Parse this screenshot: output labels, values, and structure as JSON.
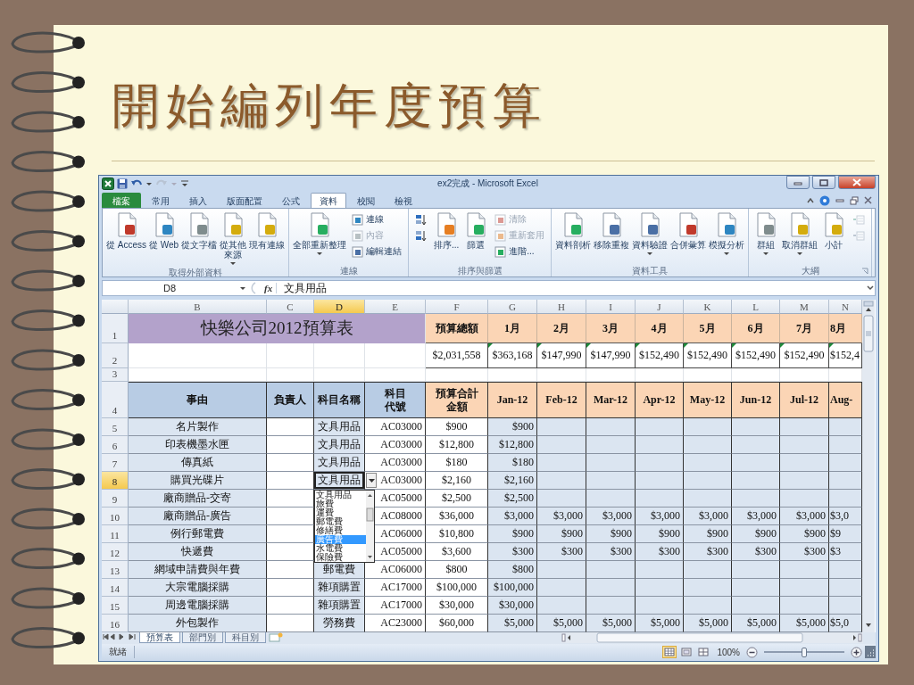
{
  "slide": {
    "title": "開始編列年度預算"
  },
  "window": {
    "title": "ex2完成 - Microsoft Excel"
  },
  "ribbon_tabs": [
    {
      "label": "檔案",
      "kind": "file",
      "selected": false
    },
    {
      "label": "常用",
      "kind": "tab",
      "selected": false
    },
    {
      "label": "插入",
      "kind": "tab",
      "selected": false
    },
    {
      "label": "版面配置",
      "kind": "tab",
      "selected": false
    },
    {
      "label": "公式",
      "kind": "tab",
      "selected": false
    },
    {
      "label": "資料",
      "kind": "tab",
      "selected": true
    },
    {
      "label": "校閱",
      "kind": "tab",
      "selected": false
    },
    {
      "label": "檢視",
      "kind": "tab",
      "selected": false
    }
  ],
  "ribbon_groups": [
    {
      "label": "取得外部資料",
      "items": [
        {
          "kind": "large",
          "label": "從 Access",
          "disabled": false
        },
        {
          "kind": "large",
          "label": "從 Web",
          "disabled": false
        },
        {
          "kind": "large",
          "label": "從文字檔",
          "disabled": false
        },
        {
          "kind": "large",
          "label": [
            "從其他",
            "來源"
          ],
          "menu": true,
          "disabled": false
        },
        {
          "kind": "large",
          "label": "現有連線",
          "disabled": false
        }
      ]
    },
    {
      "label": "連線",
      "items": [
        {
          "kind": "large",
          "label": "全部重新整理",
          "menu": true,
          "disabled": false
        },
        {
          "kind": "small",
          "label": "連線",
          "disabled": false
        },
        {
          "kind": "small",
          "label": "內容",
          "disabled": true
        },
        {
          "kind": "small",
          "label": "編輯連結",
          "disabled": false
        }
      ]
    },
    {
      "label": "排序與篩選",
      "items": [
        {
          "kind": "sort-ascending",
          "disabled": false
        },
        {
          "kind": "sort-descending",
          "disabled": false
        },
        {
          "kind": "large",
          "label": "排序...",
          "disabled": false
        },
        {
          "kind": "large",
          "label": "篩選",
          "disabled": false
        },
        {
          "kind": "small",
          "label": "清除",
          "disabled": true
        },
        {
          "kind": "small",
          "label": "重新套用",
          "disabled": true
        },
        {
          "kind": "small",
          "label": "進階...",
          "disabled": false
        }
      ]
    },
    {
      "label": "資料工具",
      "items": [
        {
          "kind": "large",
          "label": "資料剖析",
          "disabled": false
        },
        {
          "kind": "large",
          "label": "移除重複",
          "disabled": false
        },
        {
          "kind": "large",
          "label": "資料驗證",
          "menu": true,
          "disabled": false
        },
        {
          "kind": "large",
          "label": "合併彙算",
          "disabled": false
        },
        {
          "kind": "large",
          "label": "模擬分析",
          "menu": true,
          "disabled": false
        }
      ]
    },
    {
      "label": "大綱",
      "launcher": true,
      "items": [
        {
          "kind": "large",
          "label": "群組",
          "menu": true,
          "disabled": false
        },
        {
          "kind": "large",
          "label": "取消群組",
          "menu": true,
          "disabled": false
        },
        {
          "kind": "large",
          "label": "小計",
          "disabled": false
        },
        {
          "kind": "show-detail",
          "disabled": true
        },
        {
          "kind": "hide-detail",
          "disabled": true
        }
      ]
    }
  ],
  "formula_bar": {
    "name_box": "D8",
    "insert_function": "fx",
    "formula": "文具用品"
  },
  "sheet": {
    "columns": [
      {
        "letter": "B",
        "selected": false
      },
      {
        "letter": "C",
        "selected": false
      },
      {
        "letter": "D",
        "selected": true
      },
      {
        "letter": "E",
        "selected": false
      },
      {
        "letter": "F",
        "selected": false
      },
      {
        "letter": "G",
        "selected": false
      },
      {
        "letter": "H",
        "selected": false
      },
      {
        "letter": "I",
        "selected": false
      },
      {
        "letter": "J",
        "selected": false
      },
      {
        "letter": "K",
        "selected": false
      },
      {
        "letter": "L",
        "selected": false
      },
      {
        "letter": "M",
        "selected": false
      },
      {
        "letter": "N",
        "selected": false
      }
    ],
    "rows": [
      {
        "number": "1",
        "kind": "title",
        "selected": false,
        "cells": {
          "B": "快樂公司2012預算表",
          "F": "預算總額",
          "G": "1月",
          "H": "2月",
          "I": "3月",
          "J": "4月",
          "K": "5月",
          "L": "6月",
          "M": "7月",
          "N": "8月"
        }
      },
      {
        "number": "2",
        "kind": "totals",
        "selected": false,
        "cells": {
          "F": "$2,031,558",
          "G": {
            "text": "$363,168",
            "flagged": true
          },
          "H": {
            "text": "$147,990",
            "flagged": true
          },
          "I": {
            "text": "$147,990",
            "flagged": true
          },
          "J": {
            "text": "$152,490",
            "flagged": true
          },
          "K": {
            "text": "$152,490",
            "flagged": true
          },
          "L": {
            "text": "$152,490",
            "flagged": true
          },
          "M": {
            "text": "$152,490",
            "flagged": true
          },
          "N": {
            "text": "$152,4",
            "flagged": true
          }
        }
      },
      {
        "number": "3",
        "kind": "blank",
        "selected": false,
        "cells": {}
      },
      {
        "number": "4",
        "kind": "header",
        "selected": false,
        "cells": {
          "B": "事由",
          "C": "負責人",
          "D": "科目名稱",
          "E": [
            "科目",
            "代號"
          ],
          "F": [
            "預算合計",
            "金額"
          ],
          "G": "Jan-12",
          "H": "Feb-12",
          "I": "Mar-12",
          "J": "Apr-12",
          "K": "May-12",
          "L": "Jun-12",
          "M": "Jul-12",
          "N": "Aug-"
        }
      },
      {
        "number": "5",
        "kind": "item",
        "selected": false,
        "cells": {
          "B": "名片製作",
          "D": "文具用品",
          "E": "AC03000",
          "F": "$900",
          "G": "$900"
        }
      },
      {
        "number": "6",
        "kind": "item",
        "selected": false,
        "cells": {
          "B": "印表機墨水匣",
          "D": "文具用品",
          "E": "AC03000",
          "F": "$12,800",
          "G": "$12,800"
        }
      },
      {
        "number": "7",
        "kind": "item",
        "selected": false,
        "cells": {
          "B": "傳真紙",
          "D": "文具用品",
          "E": "AC03000",
          "F": "$180",
          "G": "$180"
        }
      },
      {
        "number": "8",
        "kind": "item",
        "selected": true,
        "cells": {
          "B": "購買光碟片",
          "D": "文具用品",
          "E": "AC03000",
          "F": "$2,160",
          "G": "$2,160"
        }
      },
      {
        "number": "9",
        "kind": "item",
        "selected": false,
        "cells": {
          "B": "廠商贈品-交寄",
          "E": "AC05000",
          "F": "$2,500",
          "G": "$2,500"
        }
      },
      {
        "number": "10",
        "kind": "item",
        "selected": false,
        "cells": {
          "B": "廠商贈品-廣告",
          "E": "AC08000",
          "F": "$36,000",
          "G": "$3,000",
          "H": "$3,000",
          "I": "$3,000",
          "J": "$3,000",
          "K": "$3,000",
          "L": "$3,000",
          "M": "$3,000",
          "N": "$3,0"
        }
      },
      {
        "number": "11",
        "kind": "item",
        "selected": false,
        "cells": {
          "B": "例行郵電費",
          "E": "AC06000",
          "F": "$10,800",
          "G": "$900",
          "H": "$900",
          "I": "$900",
          "J": "$900",
          "K": "$900",
          "L": "$900",
          "M": "$900",
          "N": "$9"
        }
      },
      {
        "number": "12",
        "kind": "item",
        "selected": false,
        "cells": {
          "B": "快遞費",
          "E": "AC05000",
          "F": "$3,600",
          "G": "$300",
          "H": "$300",
          "I": "$300",
          "J": "$300",
          "K": "$300",
          "L": "$300",
          "M": "$300",
          "N": "$3"
        }
      },
      {
        "number": "13",
        "kind": "item",
        "selected": false,
        "cells": {
          "B": "網域申請費與年費",
          "D": "郵電費",
          "E": "AC06000",
          "F": "$800",
          "G": "$800"
        }
      },
      {
        "number": "14",
        "kind": "item",
        "selected": false,
        "cells": {
          "B": "大宗電腦採購",
          "D": "雜項購置",
          "E": "AC17000",
          "F": "$100,000",
          "G": "$100,000"
        }
      },
      {
        "number": "15",
        "kind": "item",
        "selected": false,
        "cells": {
          "B": "周邊電腦採購",
          "D": "雜項購置",
          "E": "AC17000",
          "F": "$30,000",
          "G": "$30,000"
        }
      },
      {
        "number": "16",
        "kind": "item",
        "selected": false,
        "cells": {
          "B": "外包製作",
          "D": "勞務費",
          "E": "AC23000",
          "F": "$60,000",
          "G": "$5,000",
          "H": "$5,000",
          "I": "$5,000",
          "J": "$5,000",
          "K": "$5,000",
          "L": "$5,000",
          "M": "$5,000",
          "N": "$5,0"
        }
      }
    ],
    "dropdown": {
      "items": [
        {
          "label": "文具用品",
          "selected": false
        },
        {
          "label": "旅費",
          "selected": false
        },
        {
          "label": "運費",
          "selected": false
        },
        {
          "label": "郵電費",
          "selected": false
        },
        {
          "label": "修繕費",
          "selected": false
        },
        {
          "label": "廣告費",
          "selected": true
        },
        {
          "label": "水電費",
          "selected": false
        },
        {
          "label": "保險費",
          "selected": false
        }
      ]
    }
  },
  "sheet_tabs": [
    {
      "label": "預算表",
      "selected": true
    },
    {
      "label": "部門別",
      "selected": false
    },
    {
      "label": "科目別",
      "selected": false
    }
  ],
  "status_bar": {
    "status": "就緒",
    "view_buttons": [
      {
        "kind": "normal",
        "selected": true
      },
      {
        "kind": "page-layout",
        "selected": false
      },
      {
        "kind": "page-break",
        "selected": false
      }
    ],
    "zoom": {
      "label": "100%",
      "level": 0.5
    }
  }
}
